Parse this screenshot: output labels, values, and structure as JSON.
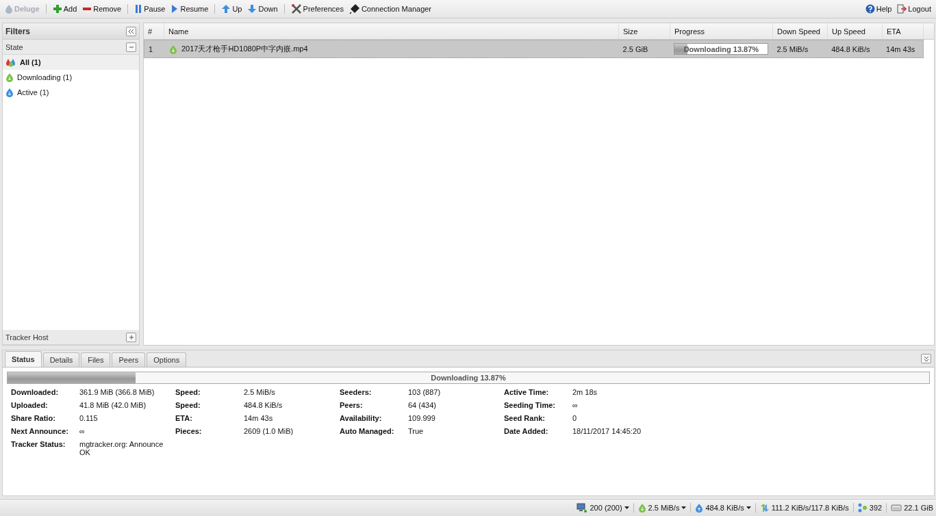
{
  "toolbar": {
    "left": [
      {
        "label": "Deluge",
        "disabled": true
      },
      {
        "label": "Add",
        "disabled": false
      },
      {
        "label": "Remove",
        "disabled": false
      },
      {
        "label": "Pause",
        "disabled": false
      },
      {
        "label": "Resume",
        "disabled": false
      },
      {
        "label": "Up",
        "disabled": false
      },
      {
        "label": "Down",
        "disabled": false
      },
      {
        "label": "Preferences",
        "disabled": false
      },
      {
        "label": "Connection Manager",
        "disabled": false
      }
    ],
    "right": [
      {
        "label": "Help"
      },
      {
        "label": "Logout"
      }
    ]
  },
  "filters": {
    "title": "Filters",
    "sections": [
      {
        "title": "State",
        "expanded": true,
        "items": [
          {
            "label": "All (1)",
            "selected": true
          },
          {
            "label": "Downloading (1)",
            "selected": false
          },
          {
            "label": "Active (1)",
            "selected": false
          }
        ]
      },
      {
        "title": "Tracker Host",
        "expanded": false
      }
    ]
  },
  "torrents": {
    "columns": [
      "#",
      "Name",
      "Size",
      "Progress",
      "Down Speed",
      "Up Speed",
      "ETA"
    ],
    "rows": [
      {
        "index": "1",
        "name": "2017天才枪手HD1080P中字内嵌.mp4",
        "size": "2.5 GiB",
        "level": 0.1387,
        "progress": "Downloading 13.87%",
        "down_speed": "2.5 MiB/s",
        "up_speed": "484.8 KiB/s",
        "eta": "14m 43s",
        "selected": true
      }
    ]
  },
  "details": {
    "tabs": [
      {
        "label": "Status",
        "selected": true
      },
      {
        "label": "Details",
        "selected": false
      },
      {
        "label": "Files",
        "selected": false
      },
      {
        "label": "Peers",
        "selected": false
      },
      {
        "label": "Options",
        "selected": false
      }
    ],
    "progress": {
      "level": 0.1387,
      "text": "Downloading 13.87%"
    },
    "columns": [
      [
        {
          "label": "Downloaded:",
          "value": "361.9 MiB (366.8 MiB)"
        },
        {
          "label": "Uploaded:",
          "value": "41.8 MiB (42.0 MiB)"
        },
        {
          "label": "Share Ratio:",
          "value": "0.115"
        },
        {
          "label": "Next Announce:",
          "value": "∞"
        },
        {
          "label": "Tracker Status:",
          "value": "mgtracker.org: Announce OK"
        }
      ],
      [
        {
          "label": "Speed:",
          "value": "2.5 MiB/s"
        },
        {
          "label": "Speed:",
          "value": "484.8 KiB/s"
        },
        {
          "label": "ETA:",
          "value": "14m 43s"
        },
        {
          "label": "Pieces:",
          "value": "2609 (1.0 MiB)"
        }
      ],
      [
        {
          "label": "Seeders:",
          "value": "103 (887)"
        },
        {
          "label": "Peers:",
          "value": "64 (434)"
        },
        {
          "label": "Availability:",
          "value": "109.999"
        },
        {
          "label": "Auto Managed:",
          "value": "True"
        }
      ],
      [
        {
          "label": "Active Time:",
          "value": "2m 18s"
        },
        {
          "label": "Seeding Time:",
          "value": "∞"
        },
        {
          "label": "Seed Rank:",
          "value": "0"
        },
        {
          "label": "Date Added:",
          "value": "18/11/2017 14:45:20"
        }
      ]
    ]
  },
  "status_bar": [
    {
      "text": "200 (200)",
      "menu": true
    },
    {
      "text": "2.5 MiB/s",
      "menu": true
    },
    {
      "text": "484.8 KiB/s",
      "menu": true
    },
    {
      "text": "111.2 KiB/s/117.8 KiB/s",
      "menu": false
    },
    {
      "text": "392",
      "menu": false
    },
    {
      "text": "22.1 GiB",
      "menu": false
    }
  ]
}
